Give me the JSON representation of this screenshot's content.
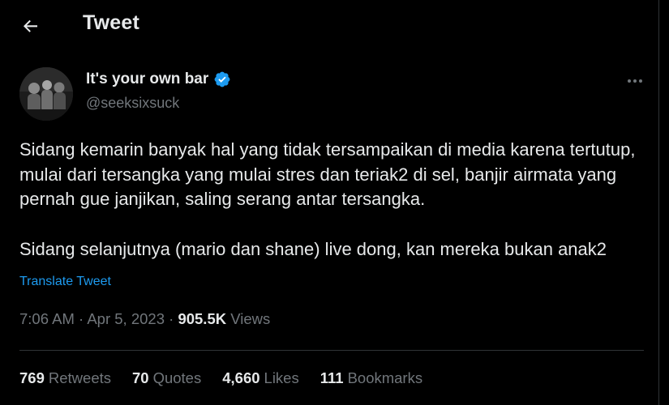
{
  "header": {
    "title": "Tweet",
    "back_icon": "arrow-left-icon"
  },
  "author": {
    "display_name": "It's your own bar",
    "handle": "@seeksixsuck",
    "verified": true,
    "verified_color": "#1d9bf0"
  },
  "tweet": {
    "paragraphs": [
      "Sidang kemarin banyak hal yang tidak tersampaikan di media karena tertutup, mulai dari tersangka yang mulai stres dan teriak2 di sel, banjir airmata yang pernah gue janjikan, saling serang antar tersangka.",
      "Sidang selanjutnya (mario dan shane) live dong, kan mereka bukan anak2"
    ],
    "translate_label": "Translate Tweet",
    "time": "7:06 AM",
    "date": "Apr 5, 2023",
    "separator": "·",
    "views_count": "905.5K",
    "views_label": "Views"
  },
  "stats": {
    "retweets_count": "769",
    "retweets_label": "Retweets",
    "quotes_count": "70",
    "quotes_label": "Quotes",
    "likes_count": "4,660",
    "likes_label": "Likes",
    "bookmarks_count": "111",
    "bookmarks_label": "Bookmarks"
  },
  "colors": {
    "background": "#000000",
    "text_primary": "#e7e9ea",
    "text_secondary": "#71767b",
    "link": "#1d9bf0",
    "divider": "#2f3336"
  }
}
